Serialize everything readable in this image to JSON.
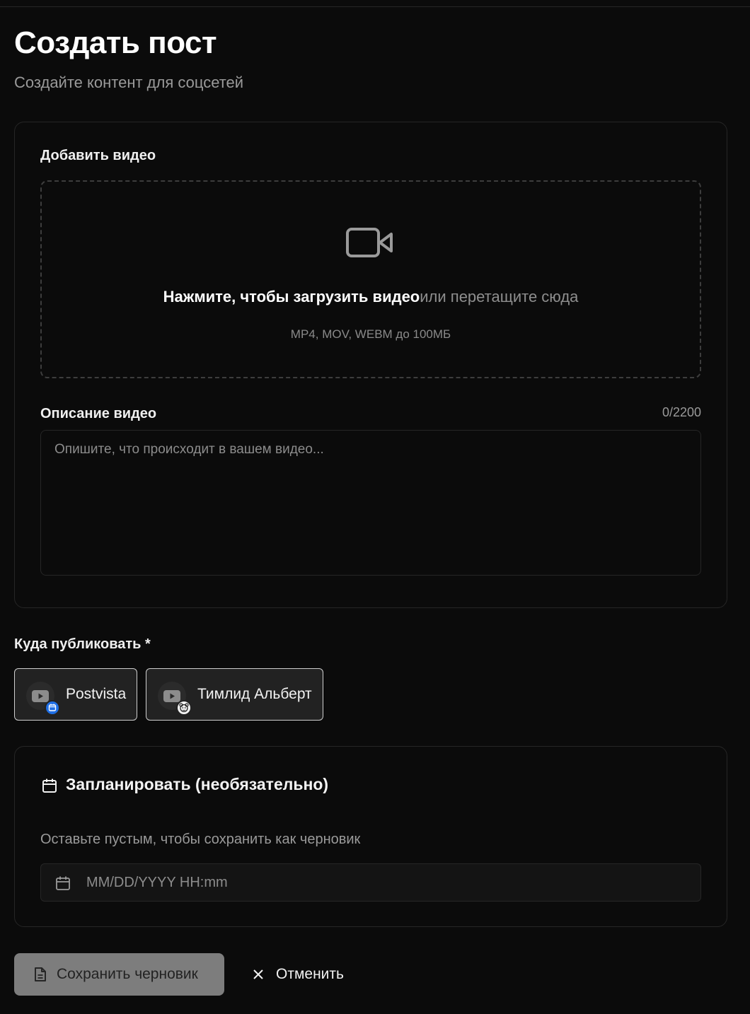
{
  "header": {
    "title": "Создать пост",
    "subtitle": "Создайте контент для соцсетей"
  },
  "video": {
    "label": "Добавить видео",
    "upload_strong": "Нажмите, чтобы загрузить видео",
    "upload_weak": "или перетащите сюда",
    "formats_hint": "MP4, MOV, WEBM до 100МБ",
    "icon": "video-camera-icon"
  },
  "description": {
    "label": "Описание видео",
    "counter": "0/2200",
    "placeholder": "Опишите, что происходит в вашем видео...",
    "value": ""
  },
  "publish": {
    "label": "Куда публиковать *",
    "channels": [
      {
        "name": "Postvista",
        "platform_icon": "youtube-icon",
        "badge_icon": "calendar-badge-icon",
        "badge_color": "#1f6fe5"
      },
      {
        "name": "Тимлид Альберт",
        "platform_icon": "youtube-icon",
        "badge_icon": "avatar-badge-icon",
        "badge_color": "#f2f2f2"
      }
    ]
  },
  "schedule": {
    "title": "Запланировать (необязательно)",
    "hint": "Оставьте пустым, чтобы сохранить как черновик",
    "placeholder": "MM/DD/YYYY HH:mm",
    "value": "",
    "icon": "calendar-icon"
  },
  "actions": {
    "save_draft": "Сохранить черновик",
    "cancel": "Отменить"
  },
  "colors": {
    "background": "#0b0b0b",
    "border": "#262626",
    "muted_text": "#9a9a9a",
    "draft_button": "#7d7d7d"
  }
}
